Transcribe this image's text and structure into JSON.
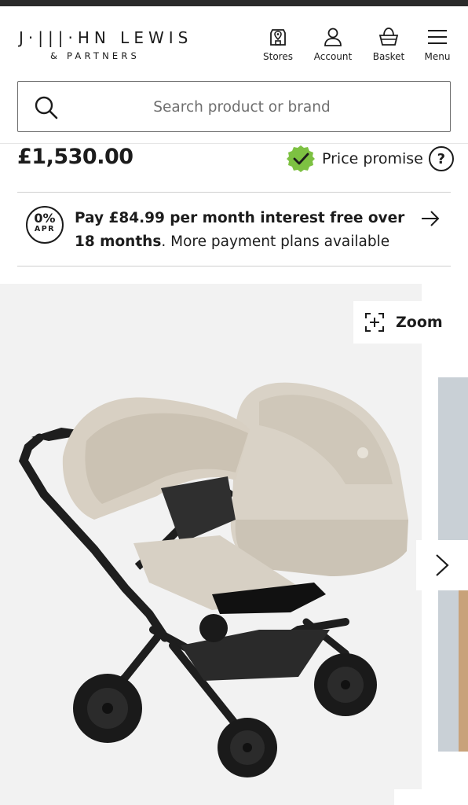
{
  "brand": {
    "name_main": "J·|||·HN LEWIS",
    "name_sub": "& PARTNERS"
  },
  "nav": [
    {
      "label": "Stores",
      "icon": "store-pin-icon"
    },
    {
      "label": "Account",
      "icon": "account-icon"
    },
    {
      "label": "Basket",
      "icon": "basket-icon"
    },
    {
      "label": "Menu",
      "icon": "menu-icon"
    }
  ],
  "search": {
    "placeholder": "Search product or brand",
    "value": ""
  },
  "product": {
    "price": "£1,530.00",
    "price_promise_label": "Price promise",
    "help_glyph": "?"
  },
  "finance": {
    "badge_pct": "0%",
    "badge_word": "APR",
    "bold_text": "Pay £84.99 per month interest free over 18 months",
    "regular_text": ". More payment plans available"
  },
  "gallery": {
    "zoom_label": "Zoom",
    "image_alt": "Bugaboo Donkey 5 twin pushchair with carrycot and seat in desert taupe on black chassis"
  },
  "colors": {
    "text": "#1c1c1c",
    "price_promise_green": "#7dc142",
    "top_strip": "#2b2b2b",
    "image_bg": "#f2f2f2"
  }
}
